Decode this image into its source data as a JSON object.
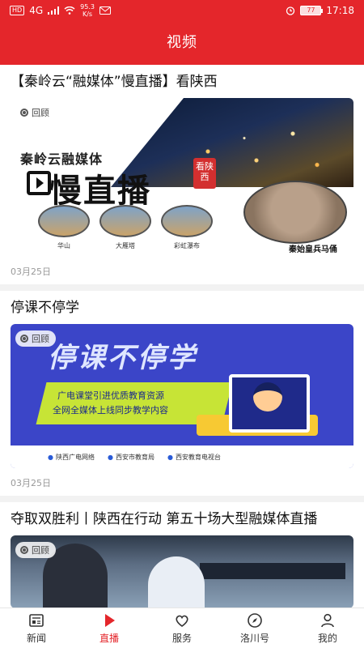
{
  "status_bar": {
    "hd": "HD",
    "network": "4G",
    "speed_value": "95.3",
    "speed_unit": "K/s",
    "battery": "77",
    "time": "17:18"
  },
  "header": {
    "title": "视频"
  },
  "feed": [
    {
      "title": "【秦岭云“融媒体”慢直播】看陕西",
      "replay_label": "回顾",
      "date": "03月25日",
      "thumb": {
        "slogan_small": "秦岭云融媒体",
        "slogan_big": "慢直播",
        "badge": "看陕西",
        "spots": [
          "华山",
          "大雁塔",
          "彩虹瀑布"
        ],
        "warriors": "秦始皇兵马俑"
      }
    },
    {
      "title": "停课不停学",
      "replay_label": "回顾",
      "date": "03月25日",
      "thumb": {
        "headline": "停课不停学",
        "line1": "广电课堂引进优质教育资源",
        "line2": "全网全媒体上线同步教学内容",
        "footer": [
          "陕西广电网络",
          "西安市教育局",
          "西安教育电视台"
        ]
      }
    },
    {
      "title": "夺取双胜利丨陕西在行动 第五十场大型融媒体直播",
      "replay_label": "回顾"
    }
  ],
  "nav": [
    {
      "label": "新闻",
      "icon": "news-icon",
      "active": false
    },
    {
      "label": "直播",
      "icon": "live-icon",
      "active": true
    },
    {
      "label": "服务",
      "icon": "service-icon",
      "active": false
    },
    {
      "label": "洛川号",
      "icon": "compass-icon",
      "active": false
    },
    {
      "label": "我的",
      "icon": "user-icon",
      "active": false
    }
  ],
  "colors": {
    "brand": "#e4262b"
  }
}
